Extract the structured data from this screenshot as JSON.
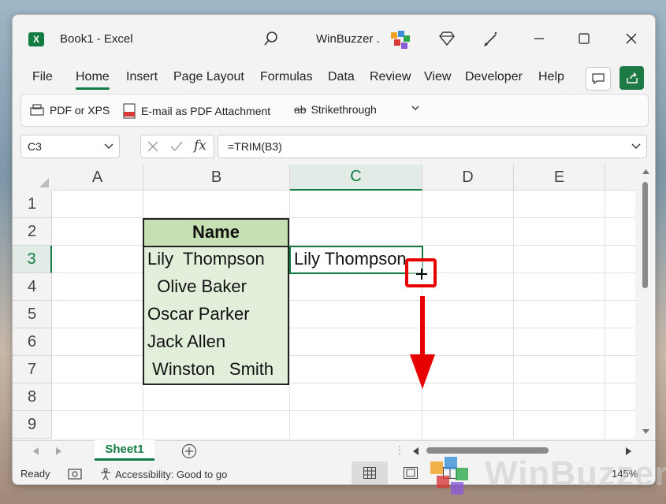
{
  "window": {
    "title": "Book1  -  Excel",
    "account": "WinBuzzer ."
  },
  "menu": [
    "File",
    "Home",
    "Insert",
    "Page Layout",
    "Formulas",
    "Data",
    "Review",
    "View",
    "Developer",
    "Help"
  ],
  "qat": {
    "pdf": "PDF or XPS",
    "email": "E-mail as PDF Attachment",
    "strike": "Strikethrough"
  },
  "namebox": "C3",
  "formula": "=TRIM(B3)",
  "columns": [
    "A",
    "B",
    "C",
    "D",
    "E"
  ],
  "rows": [
    "1",
    "2",
    "3",
    "4",
    "5",
    "6",
    "7",
    "8",
    "9"
  ],
  "cells": {
    "header": "Name",
    "b3": "Lily  Thompson",
    "b4": "  Olive Baker",
    "b5": "Oscar Parker",
    "b6": "Jack Allen",
    "b7": " Winston   Smith",
    "c3": "Lily Thompson"
  },
  "sheet": "Sheet1",
  "status": {
    "ready": "Ready",
    "accessibility": "Accessibility: Good to go",
    "zoom": "145%"
  },
  "watermark": "WinBuzzer",
  "colors": {
    "accent": "#107c41",
    "header_fill": "#c6e0b4",
    "table_fill": "#e2efda",
    "annotation": "#e60000"
  }
}
